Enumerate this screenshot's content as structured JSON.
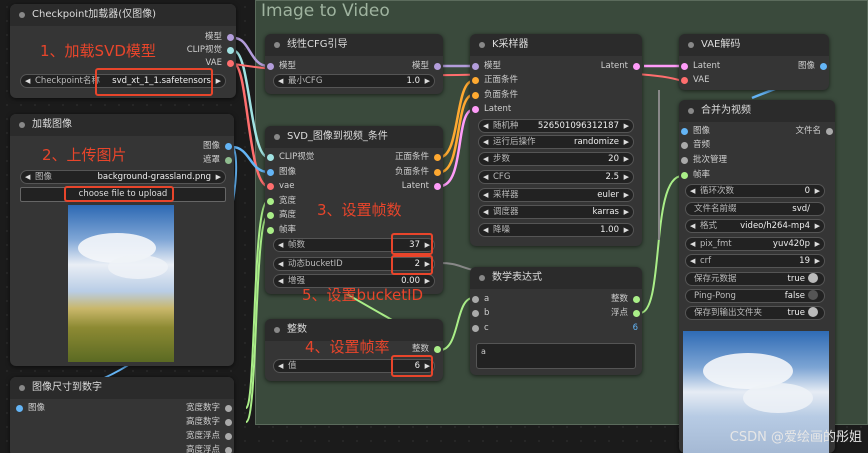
{
  "group": {
    "title": "Image to Video"
  },
  "nodes": {
    "checkpoint": {
      "title": "Checkpoint加载器(仅图像)",
      "outputs": [
        "模型",
        "CLIP视觉",
        "VAE"
      ],
      "widget_label": "Checkpoint名称",
      "widget_value": "svd_xt_1_1.safetensors"
    },
    "load_image": {
      "title": "加载图像",
      "outputs": [
        "图像",
        "遮罩"
      ],
      "widget_label": "图像",
      "widget_value": "background-grassland.png",
      "upload_label": "choose file to upload"
    },
    "image_to_number": {
      "title": "图像尺寸到数字",
      "input": "图像",
      "outputs": [
        "宽度数字",
        "高度数字",
        "宽度浮点",
        "高度浮点"
      ]
    },
    "cfg_guide": {
      "title": "线性CFG引导",
      "input": "模型",
      "output": "模型",
      "widget_label": "最小CFG",
      "widget_value": "1.0"
    },
    "svd_cond": {
      "title": "SVD_图像到视频_条件",
      "inputs": [
        "CLIP视觉",
        "图像",
        "vae",
        "宽度",
        "高度",
        "帧率"
      ],
      "outputs": [
        "正面条件",
        "负面条件",
        "Latent"
      ],
      "widgets": [
        {
          "label": "帧数",
          "value": "37"
        },
        {
          "label": "动态bucketID",
          "value": "2"
        },
        {
          "label": "增强",
          "value": "0.00"
        }
      ]
    },
    "integer": {
      "title": "整数",
      "output": "整数",
      "widget_label": "值",
      "widget_value": "6"
    },
    "ksampler": {
      "title": "K采样器",
      "inputs": [
        "模型",
        "正面条件",
        "负面条件",
        "Latent"
      ],
      "output": "Latent",
      "widgets": [
        {
          "label": "随机种",
          "value": "526501096312187"
        },
        {
          "label": "运行后操作",
          "value": "randomize"
        },
        {
          "label": "步数",
          "value": "20"
        },
        {
          "label": "CFG",
          "value": "2.5"
        },
        {
          "label": "采样器",
          "value": "euler"
        },
        {
          "label": "调度器",
          "value": "karras"
        },
        {
          "label": "降噪",
          "value": "1.00"
        }
      ]
    },
    "math": {
      "title": "数学表达式",
      "inputs": [
        "a",
        "b",
        "c"
      ],
      "outputs": [
        "整数",
        "浮点"
      ],
      "c_value": "6",
      "expression": "a"
    },
    "vae_decode": {
      "title": "VAE解码",
      "inputs": [
        "Latent",
        "VAE"
      ],
      "output": "图像"
    },
    "video_combine": {
      "title": "合并为视频",
      "inputs": [
        "图像",
        "音频",
        "批次管理",
        "帧率"
      ],
      "output": "文件名",
      "widgets": [
        {
          "label": "循环次数",
          "value": "0"
        },
        {
          "label": "文件名前缀",
          "value": "svd/"
        },
        {
          "label": "格式",
          "value": "video/h264-mp4"
        },
        {
          "label": "pix_fmt",
          "value": "yuv420p"
        },
        {
          "label": "crf",
          "value": "19"
        },
        {
          "label": "保存元数据",
          "value": "true"
        },
        {
          "label": "Ping-Pong",
          "value": "false"
        },
        {
          "label": "保存到输出文件夹",
          "value": "true"
        }
      ]
    }
  },
  "annotations": [
    "1、加载SVD模型",
    "2、上传图片",
    "3、设置帧数",
    "4、设置帧率",
    "5、设置bucketID"
  ],
  "watermark": "CSDN @爱绘画的彤姐",
  "colors": {
    "model": "#b39ddb",
    "clip_vision": "#a1e3e3",
    "vae": "#ff6e6e",
    "image": "#64b5f6",
    "latent": "#ff9cf9",
    "conditioning": "#ffa931",
    "number": "#aaee88",
    "annotation": "#e8452b"
  },
  "icons": {
    "arrow_left": "◀",
    "arrow_right": "▶"
  }
}
